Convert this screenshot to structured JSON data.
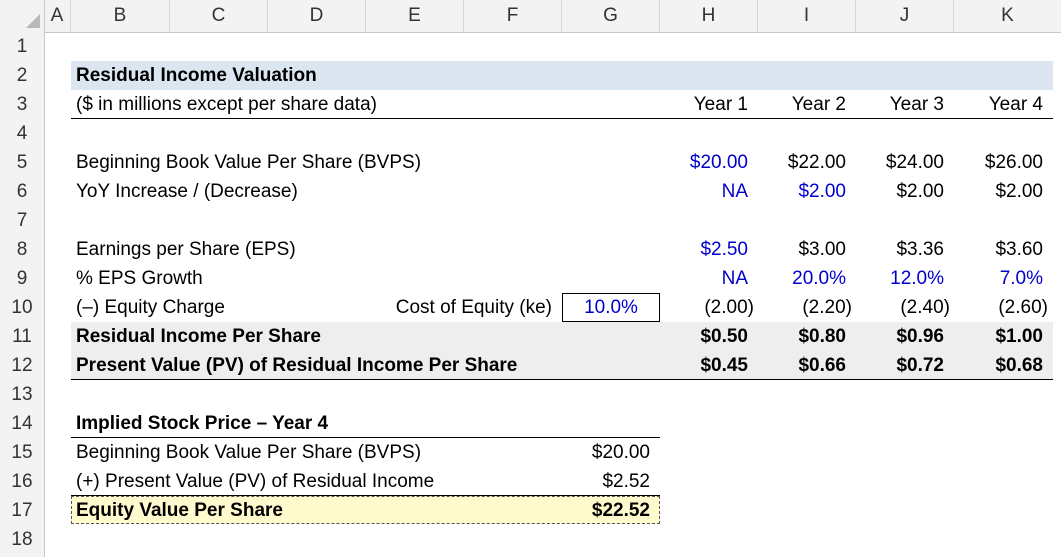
{
  "columns": [
    "A",
    "B",
    "C",
    "D",
    "E",
    "F",
    "G",
    "H",
    "I",
    "J",
    "K"
  ],
  "rows": [
    "1",
    "2",
    "3",
    "4",
    "5",
    "6",
    "7",
    "8",
    "9",
    "10",
    "11",
    "12",
    "13",
    "14",
    "15",
    "16",
    "17",
    "18"
  ],
  "title": "Residual Income Valuation",
  "subtitle": "($ in millions except per share data)",
  "years": [
    "Year 1",
    "Year 2",
    "Year 3",
    "Year 4"
  ],
  "bvps": {
    "label": "Beginning Book Value Per Share (BVPS)",
    "values": [
      "$20.00",
      "$22.00",
      "$24.00",
      "$26.00"
    ]
  },
  "yoy": {
    "label": "YoY Increase / (Decrease)",
    "values": [
      "NA",
      "$2.00",
      "$2.00",
      "$2.00"
    ]
  },
  "eps": {
    "label": "Earnings per Share (EPS)",
    "values": [
      "$2.50",
      "$3.00",
      "$3.36",
      "$3.60"
    ]
  },
  "eps_growth": {
    "label": "% EPS Growth",
    "values": [
      "NA",
      "20.0%",
      "12.0%",
      "7.0%"
    ]
  },
  "equity_charge": {
    "label": "(–) Equity Charge",
    "coe_label": "Cost of Equity (ke)",
    "coe_value": "10.0%",
    "values": [
      "(2.00)",
      "(2.20)",
      "(2.40)",
      "(2.60)"
    ]
  },
  "ri": {
    "label": "Residual Income Per Share",
    "values": [
      "$0.50",
      "$0.80",
      "$0.96",
      "$1.00"
    ]
  },
  "pv_ri": {
    "label": "Present Value (PV) of Residual Income Per Share",
    "values": [
      "$0.45",
      "$0.66",
      "$0.72",
      "$0.68"
    ]
  },
  "implied": {
    "title": "Implied Stock Price – Year 4",
    "bvps_label": "Beginning Book Value Per Share (BVPS)",
    "bvps_value": "$20.00",
    "pv_label": "(+) Present Value (PV) of Residual Income",
    "pv_value": "$2.52",
    "equity_label": "Equity Value Per Share",
    "equity_value": "$22.52"
  },
  "colors": {
    "header_band": "#dce6f1",
    "gray_band": "#eeeeee",
    "highlight": "#fffacd",
    "input_blue": "#0000cc"
  }
}
